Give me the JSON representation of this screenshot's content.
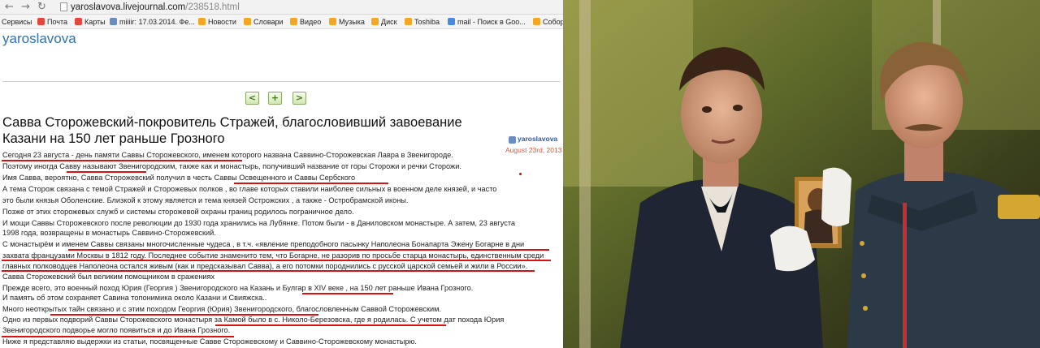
{
  "browser": {
    "address": {
      "host": "yaroslavova.livejournal.com",
      "path": "/238518.html"
    },
    "bookmarks": [
      {
        "label": "Сервисы",
        "color": "#4a8be0"
      },
      {
        "label": "Почта",
        "color": "#e8453c"
      },
      {
        "label": "Карты",
        "color": "#e8453c"
      },
      {
        "label": "miiiir: 17.03.2014. Фе...",
        "color": "#6a8cc2"
      },
      {
        "label": "Новости",
        "color": "#f5a623"
      },
      {
        "label": "Словари",
        "color": "#f5a623"
      },
      {
        "label": "Видео",
        "color": "#f5a623"
      },
      {
        "label": "Музыка",
        "color": "#f5a623"
      },
      {
        "label": "Диск",
        "color": "#f5a623"
      },
      {
        "label": "Toshiba",
        "color": "#f5a623"
      },
      {
        "label": "mail - Поиск в Goo...",
        "color": "#4a8be0"
      },
      {
        "label": "Собор",
        "color": "#f5a623"
      }
    ]
  },
  "site": {
    "title": "yaroslavova"
  },
  "post": {
    "title_line1": "Савва Сторожевский-покровитель Стражей, благословивший завоевание",
    "title_line2": "Казани на 150 лет раньше Грозного",
    "author": "yaroslavova",
    "date": "August 23rd, 2013",
    "lines": [
      "Сегодня 23  августа  -   день памяти  Саввы Сторожевского, именем  которого названа  Саввино-Сторожевская   Лавра в Звенигороде.",
      "Поэтому иногда   Савву   называют Звенигородским, также как и монастырь, получивший название от  горы  Сторожи и речки Сторожи.",
      "Имя  Савва, вероятно,     Савва    Сторожевский    получил  в честь   Саввы    Освещенного и    Саввы  Сербского",
      "А  тема  Сторож     связана с темой Стражей и Сторожевых  полков  , во главе   которых  ставили  наиболее  сильных  в военном деле князей,   и часто",
      "это были князья  Оболенские.     Близкой   к этому  является  и  тема князей  Острожских  , а также  -  Остробрамской  иконы.",
      "Позже  от этих   сторожевых   служб         и   системы сторожевой охраны   границ  родилось пограничное  дело.",
      " И мощи   Саввы  Сторожевского  после революции    до 1930 года  хранились на  Лубянке. Потом были  -  в Даниловском  монастыре. А затем,     23 августа",
      "1998 года,   возвращены в монастырь  Саввино-Сторожевский.",
      "   С монастырём и именем Саввы связаны многочисленные   чудеса ,  в т.ч.  «явление преподобного пасынку Наполеона Бонапарта Эжену Богарне в дни",
      "захвата французами Москвы в 1812 году.  Последнее событие знаменито тем, что  Богарне, не разорив по просьбе старца монастырь, единственным среди",
      "главных полководцев Наполеона остался живым (как и предсказывал Савва), а его потомки породнились с русской царской семьей и жили в России».",
      "    Савва  Сторожевский  был великим  помощником в  сражениях",
      "    Прежде  всего,  это     военный  поход   Юрия   (Георгия )  Звенигородского на   Казань  и Булгар в   XIV   веке ,    на  150  лет раньше  Ивана   Грозного.",
      "    И  память     об     этом  сохраняет Савина  топонимика  около  Казани и Свияжска..",
      "    Много  неоткрытых  тайн  связано и с этим  походом     Георгия (Юрия)  Звенигородского,  благословленным  Саввой  Сторожевским.",
      "    Одно  из первых  подворий Саввы Сторожевского  монастыря    за Камой было в с. Николо-Березовска,  где  я   родилась.   С учетом дат     похода   Юрия",
      "Звенигородского   подворье могло  появиться и  до     Ивана   Грозного.",
      "    Ниже  я представляю выдержки из    статьи,  посвященные  Савве   Сторожевскому и Саввино-Сторожевскому  монастырю."
    ]
  },
  "colors": {
    "link": "#2f70b0",
    "underline": "#dd1010",
    "date": "#d45a3c",
    "nav_green": "#3d7a12"
  },
  "icons": [
    "back-arrow-icon",
    "forward-arrow-icon",
    "reload-icon",
    "page-icon",
    "prev-post-icon",
    "add-memory-icon",
    "next-post-icon",
    "user-icon"
  ]
}
